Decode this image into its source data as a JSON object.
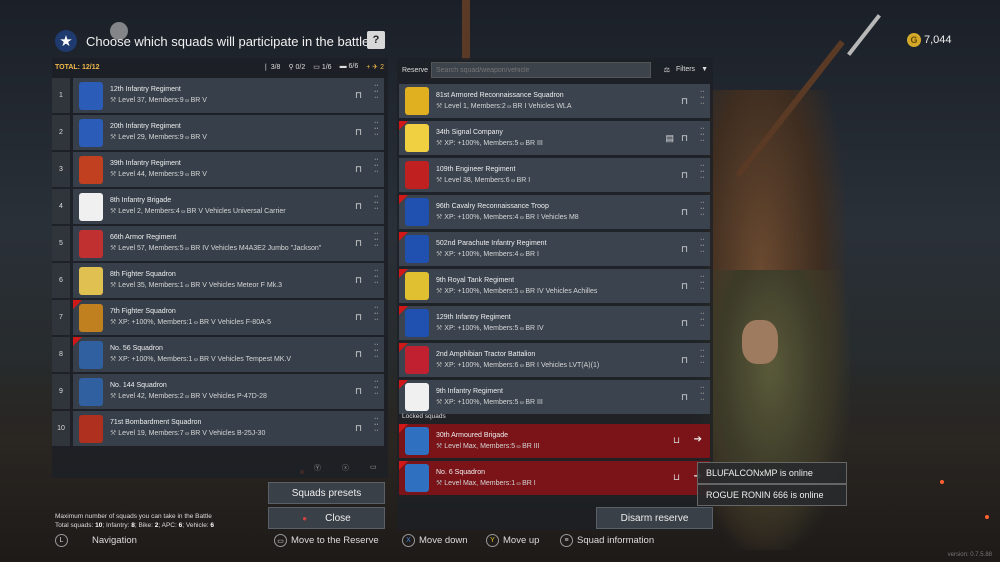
{
  "header": {
    "title": "Choose which squads will participate in the battle",
    "help_label": "?",
    "gold_amount": "7,044"
  },
  "stats": {
    "total": "TOTAL: 12/12",
    "infantry": "3/8",
    "bike": "0/2",
    "apc": "1/6",
    "vehicle": "6/6",
    "plane": "2"
  },
  "squads": [
    {
      "num": "1",
      "name": "12th Infantry Regiment",
      "info": "Level 37, Members:9",
      "br": "BR V",
      "vehicle": "",
      "color": "#2a5cb8",
      "new": false
    },
    {
      "num": "2",
      "name": "20th Infantry Regiment",
      "info": "Level 29, Members:9",
      "br": "BR V",
      "vehicle": "",
      "color": "#2a5cb8",
      "new": false
    },
    {
      "num": "3",
      "name": "39th Infantry Regiment",
      "info": "Level 44, Members:9",
      "br": "BR V",
      "vehicle": "",
      "color": "#c04020",
      "new": false
    },
    {
      "num": "4",
      "name": "8th Infantry Brigade",
      "info": "Level 2, Members:4",
      "br": "BR V",
      "vehicle": "Vehicles Universal Carrier",
      "color": "#f0f0f0",
      "new": false
    },
    {
      "num": "5",
      "name": "66th Armor Regiment",
      "info": "Level 57, Members:5",
      "br": "BR IV",
      "vehicle": "Vehicles M4A3E2 Jumbo \"Jackson\"",
      "color": "#c03030",
      "new": false
    },
    {
      "num": "6",
      "name": "8th Fighter Squadron",
      "info": "Level 35, Members:1",
      "br": "BR V",
      "vehicle": "Vehicles Meteor F Mk.3",
      "color": "#e0c050",
      "new": false
    },
    {
      "num": "7",
      "name": "7th Fighter Squadron",
      "info": "XP: +100%, Members:1",
      "br": "BR V",
      "vehicle": "Vehicles F-80A-5",
      "color": "#c08020",
      "new": true
    },
    {
      "num": "8",
      "name": "No. 56 Squadron",
      "info": "XP: +100%, Members:1",
      "br": "BR V",
      "vehicle": "Vehicles Tempest MK.V",
      "color": "#3060a0",
      "new": true
    },
    {
      "num": "9",
      "name": "No. 144 Squadron",
      "info": "Level 42, Members:2",
      "br": "BR V",
      "vehicle": "Vehicles P-47D-28",
      "color": "#3060a0",
      "new": false
    },
    {
      "num": "10",
      "name": "71st Bombardment Squadron",
      "info": "Level 19, Members:7",
      "br": "BR V",
      "vehicle": "Vehicles B-25J-30",
      "color": "#b03020",
      "new": false
    }
  ],
  "reserve": {
    "label": "Reserve",
    "search_placeholder": "Search squad/weapon/vehicle",
    "filters_label": "Filters",
    "items": [
      {
        "name": "81st Armored Reconnaissance Squadron",
        "info": "Level 1, Members:2",
        "br": "BR I",
        "vehicle": "Vehicles WLA",
        "color": "#e0b020",
        "new": false
      },
      {
        "name": "34th Signal Company",
        "info": "XP: +100%, Members:5",
        "br": "BR III",
        "vehicle": "",
        "color": "#f0d040",
        "new": true
      },
      {
        "name": "109th Engineer Regiment",
        "info": "Level 38, Members:6",
        "br": "BR I",
        "vehicle": "",
        "color": "#c02020",
        "new": false
      },
      {
        "name": "96th Cavalry Reconnaissance Troop",
        "info": "XP: +100%, Members:4",
        "br": "BR I",
        "vehicle": "Vehicles M8",
        "color": "#2050b0",
        "new": true
      },
      {
        "name": "502nd Parachute Infantry Regiment",
        "info": "XP: +100%, Members:4",
        "br": "BR I",
        "vehicle": "",
        "color": "#2050b0",
        "new": true
      },
      {
        "name": "9th Royal Tank Regiment",
        "info": "XP: +100%, Members:5",
        "br": "BR IV",
        "vehicle": "Vehicles Achilles",
        "color": "#e0c030",
        "new": true
      },
      {
        "name": "129th Infantry Regiment",
        "info": "XP: +100%, Members:5",
        "br": "BR IV",
        "vehicle": "",
        "color": "#2050b0",
        "new": true
      },
      {
        "name": "2nd Amphibian Tractor Battalion",
        "info": "XP: +100%, Members:6",
        "br": "BR I",
        "vehicle": "Vehicles LVT(A)(1)",
        "color": "#c02030",
        "new": true
      },
      {
        "name": "9th Infantry Regiment",
        "info": "XP: +100%, Members:5",
        "br": "BR III",
        "vehicle": "",
        "color": "#f0f0f0",
        "new": true
      }
    ],
    "locked_label": "Locked squads",
    "locked": [
      {
        "name": "30th Armoured Brigade",
        "info": "Level Max, Members:5",
        "br": "BR III",
        "color": "#3070c0"
      },
      {
        "name": "No. 6 Squadron",
        "info": "Level Max, Members:1",
        "br": "BR I",
        "color": "#3070c0"
      }
    ]
  },
  "buttons": {
    "presets": "Squads presets",
    "close": "Close",
    "disarm": "Disarm reserve"
  },
  "max_text": {
    "line1": "Maximum number of squads you can take in the Battle",
    "line2_prefix": "Total squads: ",
    "total": "10",
    "infantry_label": "; Infantry: ",
    "infantry": "8",
    "bike_label": "; Bike: ",
    "bike": "2",
    "apc_label": "; APC: ",
    "apc": "6",
    "vehicle_label": "; Vehicle: ",
    "vehicle": "6"
  },
  "nav": {
    "navigation": "Navigation",
    "move_reserve": "Move to the Reserve",
    "move_down": "Move down",
    "move_up": "Move up",
    "squad_info": "Squad information"
  },
  "toasts": [
    "BLUFALCONxMP is online",
    "ROGUE RONIN 666 is online"
  ],
  "version": "version: 0.7.5.88"
}
